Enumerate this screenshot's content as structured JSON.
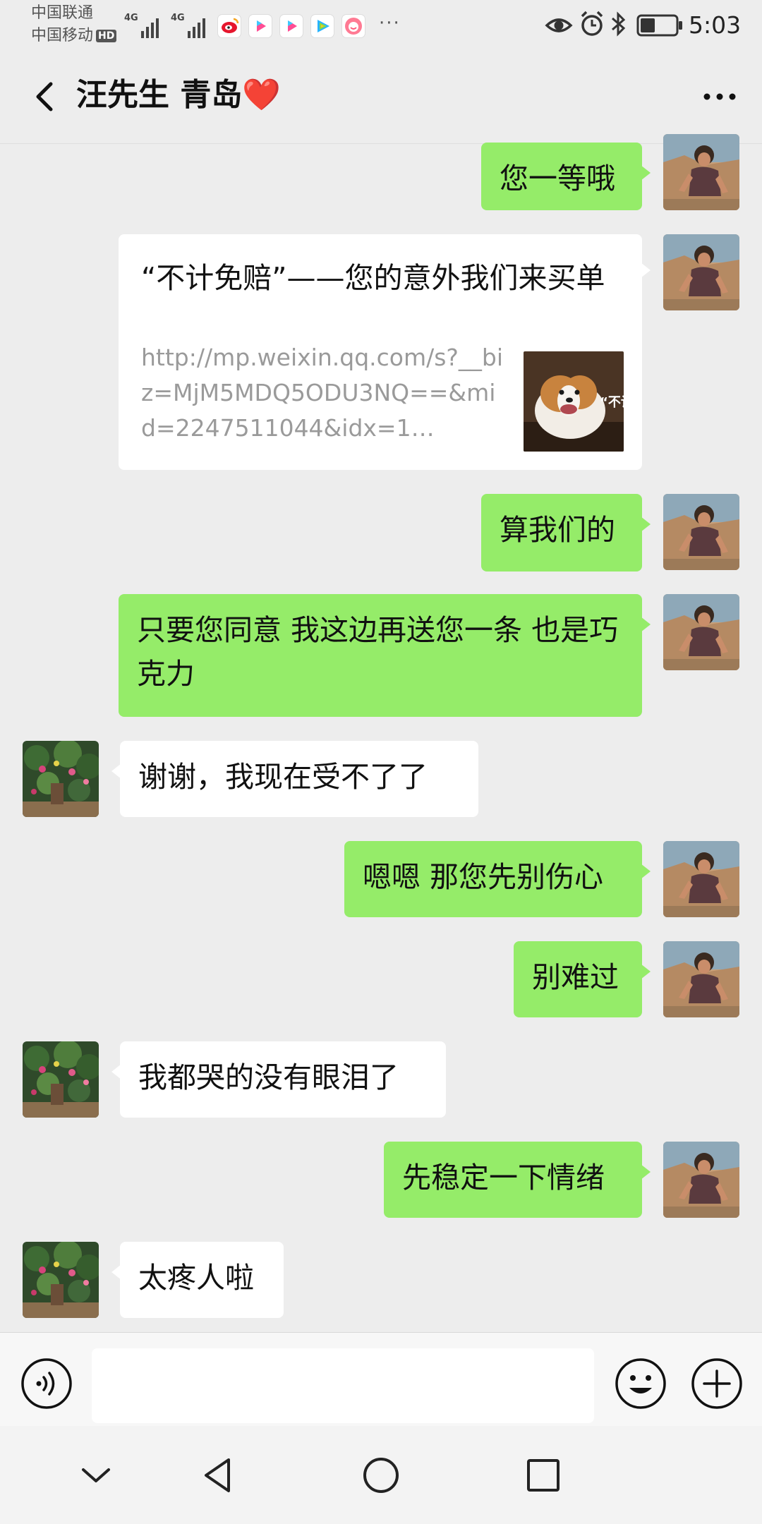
{
  "status_bar": {
    "carrier_1": "中国联通",
    "carrier_2": "中国移动",
    "hd_badge": "HD",
    "network_1": "4G",
    "network_2": "4G",
    "overflow": "···",
    "time": "5:03"
  },
  "header": {
    "title": "汪先生 青岛❤️"
  },
  "messages": [
    {
      "side": "out",
      "text": "您一等哦"
    },
    {
      "side": "out",
      "type": "link",
      "title": "“不计免赔”——您的意外我们来买单",
      "url": "http://mp.weixin.qq.com/s?__biz=MjM5MDQ5ODU3NQ==&mid=2247511044&idx=1…",
      "thumb_text": "“不计"
    },
    {
      "side": "out",
      "text": "算我们的"
    },
    {
      "side": "out",
      "text": "只要您同意 我这边再送您一条 也是巧克力"
    },
    {
      "side": "in",
      "text": "谢谢，我现在受不了了"
    },
    {
      "side": "out",
      "text": "嗯嗯 那您先别伤心"
    },
    {
      "side": "out",
      "text": "别难过"
    },
    {
      "side": "in",
      "text": "我都哭的没有眼泪了"
    },
    {
      "side": "out",
      "text": "先稳定一下情绪"
    },
    {
      "side": "in",
      "text": "太疼人啦"
    }
  ],
  "input_bar": {
    "text_value": "",
    "icons": [
      "voice-icon",
      "emoji-icon",
      "plus-icon"
    ]
  },
  "nav_bar": {
    "icons": [
      "chevron-down-icon",
      "back-triangle-icon",
      "home-circle-icon",
      "recents-square-icon"
    ]
  },
  "colors": {
    "outgoing_bubble": "#95ec69",
    "incoming_bubble": "#ffffff",
    "background": "#ededed"
  }
}
